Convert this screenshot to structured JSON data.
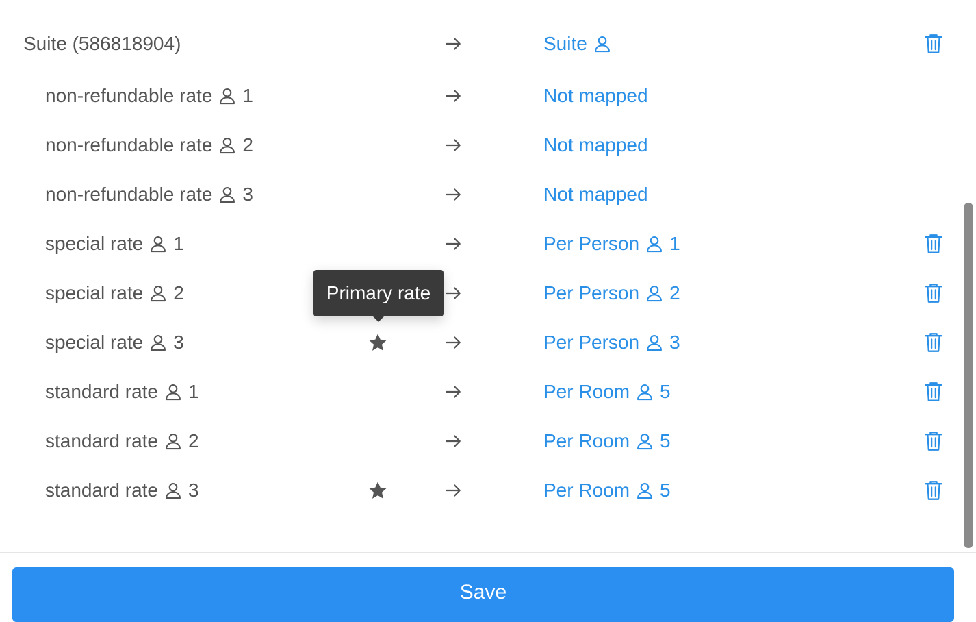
{
  "mapping": {
    "room": {
      "source": "Suite (586818904)",
      "target": "Suite"
    },
    "rates": [
      {
        "source": "non-refundable rate",
        "source_occupancy": "1",
        "target": "Not mapped",
        "target_occupancy": "",
        "primary": false,
        "deletable": false
      },
      {
        "source": "non-refundable rate",
        "source_occupancy": "2",
        "target": "Not mapped",
        "target_occupancy": "",
        "primary": false,
        "deletable": false
      },
      {
        "source": "non-refundable rate",
        "source_occupancy": "3",
        "target": "Not mapped",
        "target_occupancy": "",
        "primary": false,
        "deletable": false
      },
      {
        "source": "special rate",
        "source_occupancy": "1",
        "target": "Per Person",
        "target_occupancy": "1",
        "primary": false,
        "deletable": true
      },
      {
        "source": "special rate",
        "source_occupancy": "2",
        "target": "Per Person",
        "target_occupancy": "2",
        "primary": false,
        "deletable": true
      },
      {
        "source": "special rate",
        "source_occupancy": "3",
        "target": "Per Person",
        "target_occupancy": "3",
        "primary": true,
        "deletable": true
      },
      {
        "source": "standard rate",
        "source_occupancy": "1",
        "target": "Per Room",
        "target_occupancy": "5",
        "primary": false,
        "deletable": true
      },
      {
        "source": "standard rate",
        "source_occupancy": "2",
        "target": "Per Room",
        "target_occupancy": "5",
        "primary": false,
        "deletable": true
      },
      {
        "source": "standard rate",
        "source_occupancy": "3",
        "target": "Per Room",
        "target_occupancy": "5",
        "primary": true,
        "deletable": true
      }
    ]
  },
  "tooltip": {
    "text": "Primary rate"
  },
  "footer": {
    "save_label": "Save"
  },
  "icons": {
    "arrow": "arrow-right-icon",
    "person": "person-icon",
    "star": "star-icon",
    "trash": "trash-icon"
  },
  "colors": {
    "link": "#2a8fe6",
    "text": "#555555",
    "primary_button": "#2a8ff0",
    "tooltip_bg": "#3a3a3a"
  }
}
